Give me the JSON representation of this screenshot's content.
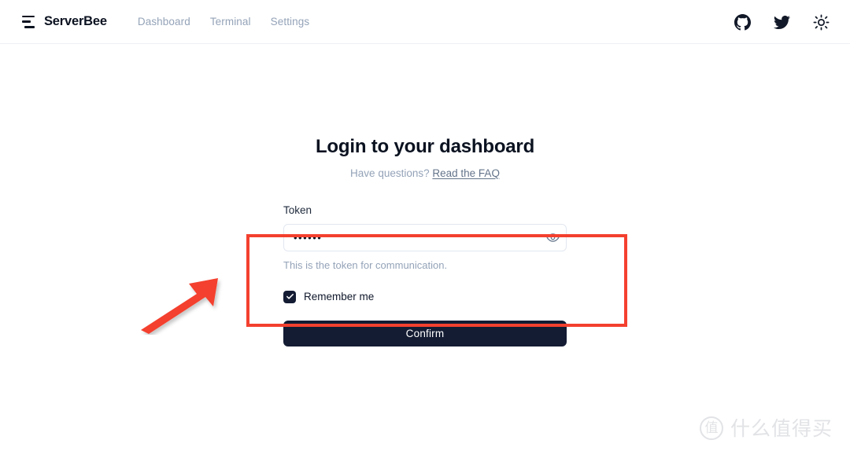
{
  "header": {
    "logo_icon": "menu-lines-icon",
    "brand": "ServerBee",
    "nav": [
      {
        "label": "Dashboard",
        "name": "nav-dashboard"
      },
      {
        "label": "Terminal",
        "name": "nav-terminal"
      },
      {
        "label": "Settings",
        "name": "nav-settings"
      }
    ],
    "actions": [
      {
        "icon": "github-icon"
      },
      {
        "icon": "twitter-icon"
      },
      {
        "icon": "sun-icon"
      }
    ]
  },
  "login": {
    "title": "Login to your dashboard",
    "subtitle_prefix": "Have questions?",
    "subtitle_link": "Read the FAQ",
    "token_label": "Token",
    "token_value": "••••••",
    "token_placeholder": "",
    "token_reveal_icon": "eye-icon",
    "help_text": "This is the token for communication.",
    "remember_label": "Remember me",
    "remember_checked": true,
    "confirm_label": "Confirm"
  },
  "annotations": {
    "highlight_color": "#f4402f",
    "arrow_color": "#f4402f"
  },
  "watermark": {
    "badge": "值",
    "text": "什么值得买"
  },
  "colors": {
    "accent_dark": "#131c33",
    "muted": "#94a3b8",
    "border": "#e2e8f0"
  }
}
